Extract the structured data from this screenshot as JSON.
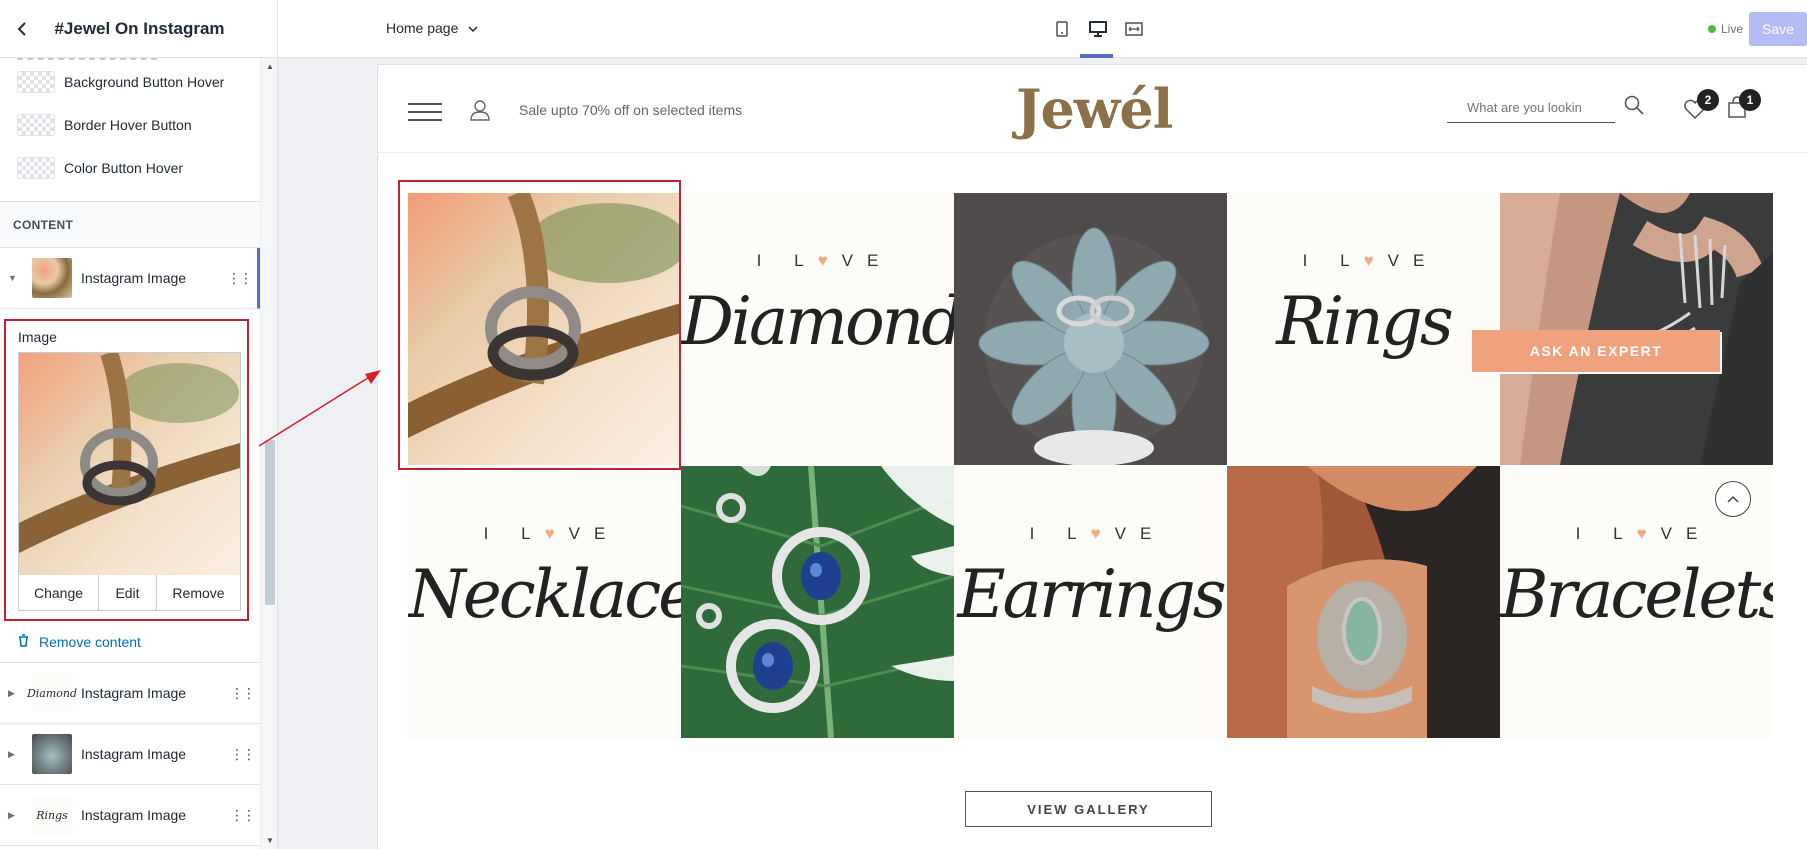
{
  "sidebar": {
    "title": "#Jewel On Instagram",
    "swatches": [
      {
        "label": "Background Button Hover"
      },
      {
        "label": "Border Hover Button"
      },
      {
        "label": "Color Button Hover"
      }
    ],
    "section_label": "CONTENT",
    "active_block": {
      "label": "Instagram Image"
    },
    "image_editor": {
      "label": "Image",
      "change": "Change",
      "edit": "Edit",
      "remove": "Remove"
    },
    "remove_content": "Remove content",
    "blocks": [
      {
        "label": "Instagram Image"
      },
      {
        "label": "Instagram Image"
      },
      {
        "label": "Instagram Image"
      }
    ]
  },
  "topbar": {
    "page_selector": "Home page",
    "live_label": "Live",
    "save_label": "Save",
    "icons": [
      "mobile-view-icon",
      "desktop-view-icon",
      "fullscreen-view-icon"
    ]
  },
  "store": {
    "promo": "Sale upto 70% off on selected items",
    "logo": "Jewél",
    "search_placeholder": "What are you lookin",
    "wishlist_count": "2",
    "cart_count": "1",
    "tiles": [
      {
        "kind": "image",
        "name": "ring-on-branch"
      },
      {
        "kind": "text",
        "ilove": "I L♥VE",
        "word": "Diamond"
      },
      {
        "kind": "image",
        "name": "rings-on-succulent"
      },
      {
        "kind": "text",
        "ilove": "I L♥VE",
        "word": "Rings"
      },
      {
        "kind": "image",
        "name": "skeleton-hand-bracelet"
      },
      {
        "kind": "text",
        "ilove": "I L♥VE",
        "word": "Necklaces"
      },
      {
        "kind": "image",
        "name": "sapphire-earrings-on-leaf"
      },
      {
        "kind": "text",
        "ilove": "I L♥VE",
        "word": "Earrings"
      },
      {
        "kind": "image",
        "name": "wrist-stone-bracelet"
      },
      {
        "kind": "text",
        "ilove": "I L♥VE",
        "word": "Bracelets"
      }
    ],
    "ask_expert": "ASK AN EXPERT",
    "view_gallery": "VIEW GALLERY"
  },
  "colors": {
    "accent": "#5c6ac4",
    "highlight": "#c4212e",
    "brand": "#8b7048",
    "peach": "#f0a27e"
  }
}
